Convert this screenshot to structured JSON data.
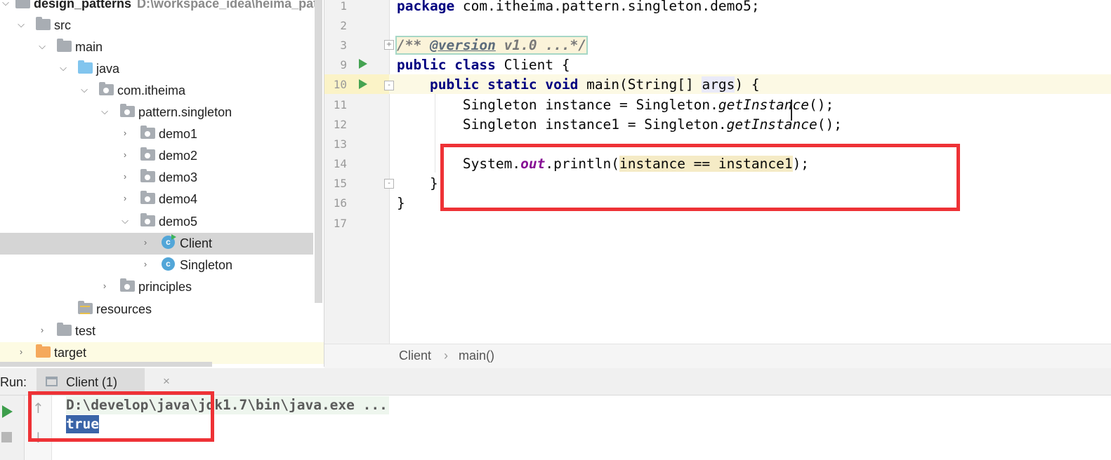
{
  "tree": {
    "items": [
      {
        "label": "design_patterns",
        "path": "D:\\workspace_idea\\heima_patt",
        "icon": "module-folder-icon",
        "expanded": true
      },
      {
        "label": "src",
        "icon": "folder-icon",
        "expanded": true
      },
      {
        "label": "main",
        "icon": "folder-icon",
        "expanded": true
      },
      {
        "label": "java",
        "icon": "source-root-folder-icon",
        "expanded": true
      },
      {
        "label": "com.itheima",
        "icon": "package-icon",
        "expanded": true
      },
      {
        "label": "pattern.singleton",
        "icon": "package-icon",
        "expanded": true
      },
      {
        "label": "demo1",
        "icon": "package-icon",
        "expanded": false
      },
      {
        "label": "demo2",
        "icon": "package-icon",
        "expanded": false
      },
      {
        "label": "demo3",
        "icon": "package-icon",
        "expanded": false
      },
      {
        "label": "demo4",
        "icon": "package-icon",
        "expanded": false
      },
      {
        "label": "demo5",
        "icon": "package-icon",
        "expanded": true
      },
      {
        "label": "Client",
        "icon": "class-runnable-icon",
        "expanded": false,
        "selected": true
      },
      {
        "label": "Singleton",
        "icon": "class-icon",
        "expanded": false
      },
      {
        "label": "principles",
        "icon": "package-icon",
        "expanded": false
      },
      {
        "label": "resources",
        "icon": "resources-folder-icon"
      },
      {
        "label": "test",
        "icon": "folder-icon",
        "expanded": false
      },
      {
        "label": "target",
        "icon": "excluded-folder-icon",
        "expanded": false
      }
    ]
  },
  "editor": {
    "line_numbers": [
      "1",
      "2",
      "3",
      "9",
      "10",
      "11",
      "12",
      "13",
      "14",
      "15",
      "16",
      "17"
    ],
    "code": {
      "l1_kw": "package",
      "l1_rest": " com.itheima.pattern.singleton.demo5;",
      "l3_open": "/** ",
      "l3_tag": "@version",
      "l3_rest": " v1.0 ...*/",
      "l9_kw1": "public",
      "l9_kw2": "class",
      "l9_rest": " Client {",
      "l10_kw1": "public",
      "l10_kw2": "static",
      "l10_kw3": "void",
      "l10_a": " main(String[] ",
      "l10_arg": "args",
      "l10_b": ") {",
      "l11_a": "Singleton instance = Singleton.",
      "l11_call": "getInstance",
      "l11_b": "();",
      "l12_a": "Singleton instance1 = Singleton.",
      "l12_call": "getInstance",
      "l12_b": "();",
      "l14_a": "System.",
      "l14_field": "out",
      "l14_b": ".println(",
      "l14_expr": "instance == instance1",
      "l14_c": ");",
      "l15": "}",
      "l16": "}"
    },
    "breadcrumb": {
      "class": "Client",
      "separator": "›",
      "method": "main()"
    }
  },
  "run": {
    "label": "Run:",
    "tab_label": "Client (1)",
    "tab_close": "×",
    "console": {
      "command": "D:\\develop\\java\\jdk1.7\\bin\\java.exe ...",
      "output": "true"
    }
  },
  "colors": {
    "keyword": "#0033b3",
    "annotation_box": "#ee3236",
    "run_green": "#3d9e4c",
    "selection": "#3a64a8"
  }
}
